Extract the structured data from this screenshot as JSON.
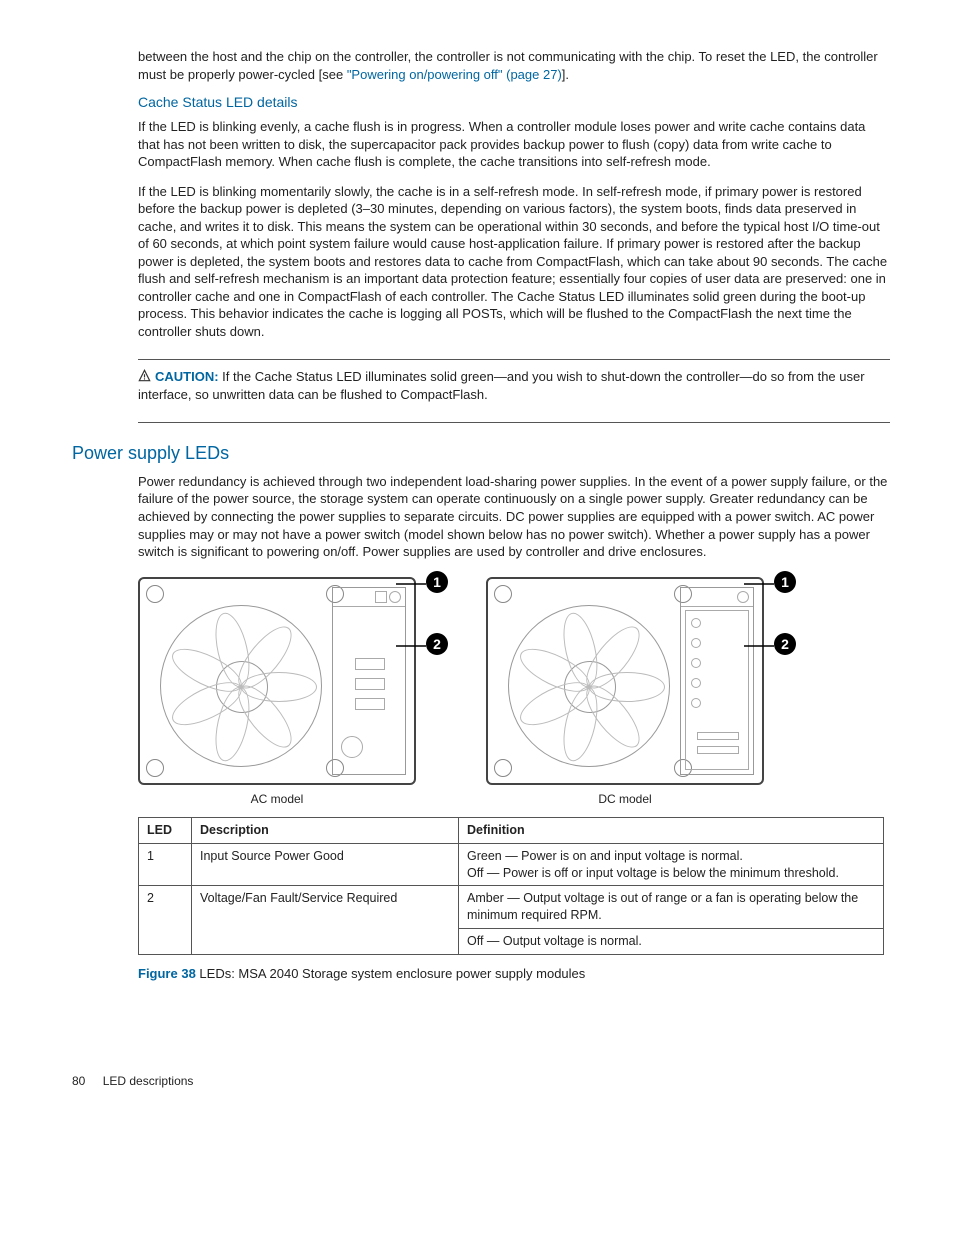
{
  "intro": {
    "text_pre": "between the host and the chip on the controller, the controller is not communicating with the chip. To reset the LED, the controller must be properly power-cycled [see ",
    "link": "\"Powering on/powering off\" (page 27)",
    "text_post": "]."
  },
  "cache": {
    "heading": "Cache Status LED details",
    "para1": "If the LED is blinking evenly, a cache flush is in progress. When a controller module loses power and write cache contains data that has not been written to disk, the supercapacitor pack provides backup power to flush (copy) data from write cache to CompactFlash memory. When cache flush is complete, the cache transitions into self-refresh mode.",
    "para2": "If the LED is blinking momentarily slowly, the cache is in a self-refresh mode. In self-refresh mode, if primary power is restored before the backup power is depleted (3–30 minutes, depending on various factors), the system boots, finds data preserved in cache, and writes it to disk. This means the system can be operational within 30 seconds, and before the typical host I/O time-out of 60 seconds, at which point system failure would cause host-application failure. If primary power is restored after the backup power is depleted, the system boots and restores data to cache from CompactFlash, which can take about 90 seconds. The cache flush and self-refresh mechanism is an important data protection feature; essentially four copies of user data are preserved: one in controller cache and one in CompactFlash of each controller. The Cache Status LED illuminates solid green during the boot-up process. This behavior indicates the cache is logging all POSTs, which will be flushed to the CompactFlash the next time the controller shuts down."
  },
  "caution": {
    "label": "CAUTION:",
    "text": "If the Cache Status LED illuminates solid green—and you wish to shut-down the controller—do so from the user interface, so unwritten data can be flushed to CompactFlash."
  },
  "power": {
    "heading": "Power supply LEDs",
    "para": "Power redundancy is achieved through two independent load-sharing power supplies. In the event of a power supply failure, or the failure of the power source, the storage system can operate continuously on a single power supply. Greater redundancy can be achieved by connecting the power supplies to separate circuits. DC power supplies are equipped with a power switch. AC power supplies may or may not have a power switch (model shown below has no power switch). Whether a power supply has a power switch is significant to powering on/off. Power supplies are used by controller and drive enclosures."
  },
  "figure": {
    "callout1": "1",
    "callout2": "2",
    "ac_caption": "AC model",
    "dc_caption": "DC model",
    "label": "Figure 38",
    "caption": "LEDs: MSA 2040 Storage system enclosure power supply modules"
  },
  "table": {
    "headers": {
      "led": "LED",
      "desc": "Description",
      "def": "Definition"
    },
    "rows": [
      {
        "led": "1",
        "desc": "Input Source Power Good",
        "def": "Green — Power is on and input voltage is normal.\nOff — Power is off or input voltage is below the minimum threshold."
      },
      {
        "led": "2",
        "desc": "Voltage/Fan Fault/Service Required",
        "def": "Amber — Output voltage is out of range or a fan is operating below the minimum required RPM.",
        "def2": "Off — Output voltage is normal."
      }
    ]
  },
  "footer": {
    "page": "80",
    "section": "LED descriptions"
  }
}
